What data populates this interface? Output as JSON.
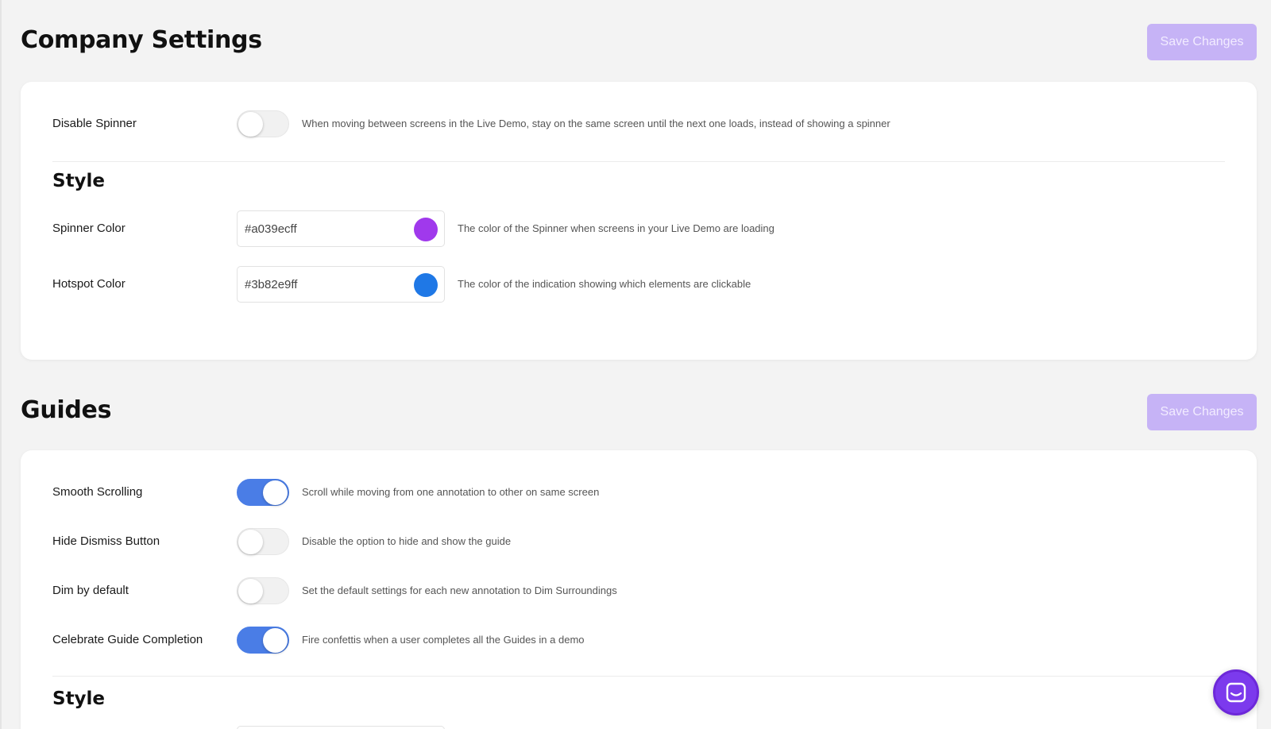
{
  "company_settings": {
    "title": "Company Settings",
    "save_label": "Save Changes",
    "disable_spinner": {
      "label": "Disable Spinner",
      "enabled": false,
      "description": "When moving between screens in the Live Demo, stay on the same screen until the next one loads, instead of showing a spinner"
    },
    "style": {
      "heading": "Style",
      "spinner_color": {
        "label": "Spinner Color",
        "value": "#a039ecff",
        "swatch": "#a039ec",
        "description": "The color of the Spinner when screens in your Live Demo are loading"
      },
      "hotspot_color": {
        "label": "Hotspot Color",
        "value": "#3b82e9ff",
        "swatch": "#1f78e6",
        "description": "The color of the indication showing which elements are clickable"
      }
    }
  },
  "guides": {
    "title": "Guides",
    "save_label": "Save Changes",
    "toggles": [
      {
        "label": "Smooth Scrolling",
        "enabled": true,
        "description": "Scroll while moving from one annotation to other on same screen"
      },
      {
        "label": "Hide Dismiss Button",
        "enabled": false,
        "description": "Disable the option to hide and show the guide"
      },
      {
        "label": "Dim by default",
        "enabled": false,
        "description": "Set the default settings for each new annotation to Dim Surroundings"
      },
      {
        "label": "Celebrate Guide Completion",
        "enabled": true,
        "description": "Fire confettis when a user completes all the Guides in a demo"
      }
    ],
    "style_heading": "Style"
  },
  "chat_widget": {
    "icon": "chat-icon",
    "color": "#7c3aed"
  }
}
